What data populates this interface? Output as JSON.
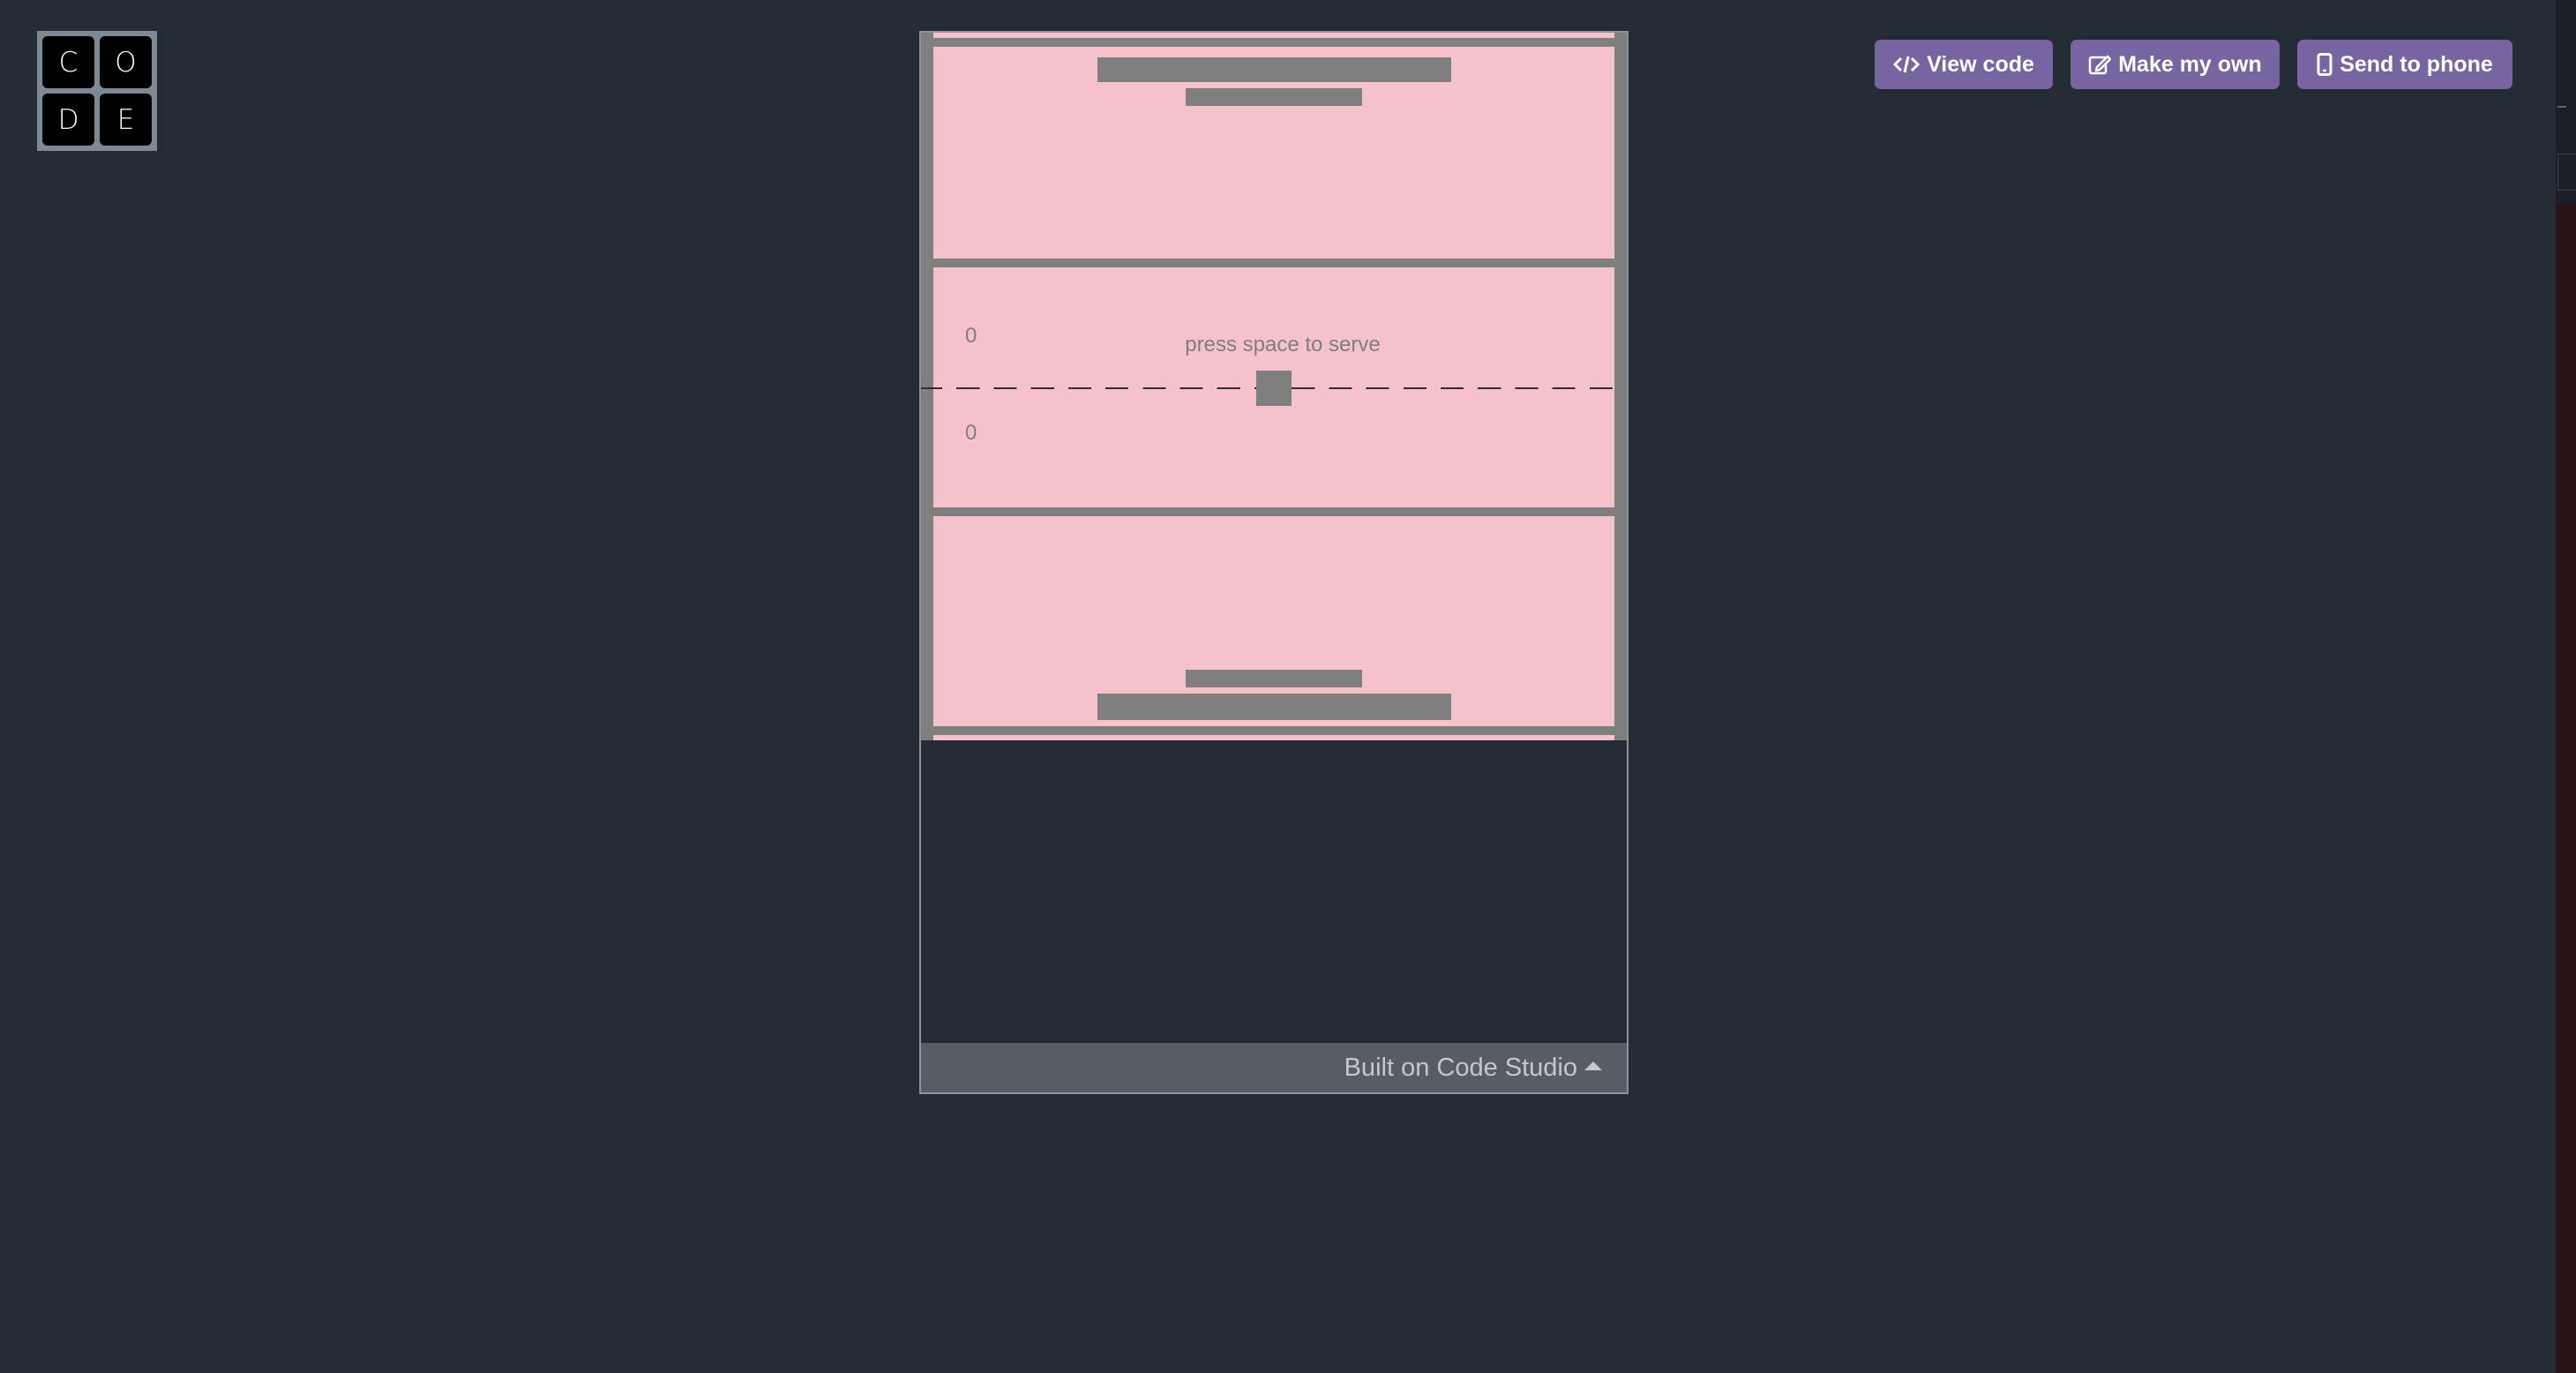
{
  "logo": {
    "letters": [
      "C",
      "O",
      "D",
      "E"
    ]
  },
  "header": {
    "view_code": {
      "label": "View code",
      "icon": "code-icon"
    },
    "make_my_own": {
      "label": "Make my own",
      "icon": "edit-icon"
    },
    "send_to_phone": {
      "label": "Send to phone",
      "icon": "phone-icon"
    }
  },
  "game": {
    "top_score": "0",
    "bottom_score": "0",
    "prompt": "press space to serve",
    "background_color": "#f5c1cb",
    "sprite_color": "#7f7f7f"
  },
  "footer": {
    "label": "Built on Code Studio",
    "icon": "caret-up-icon"
  }
}
